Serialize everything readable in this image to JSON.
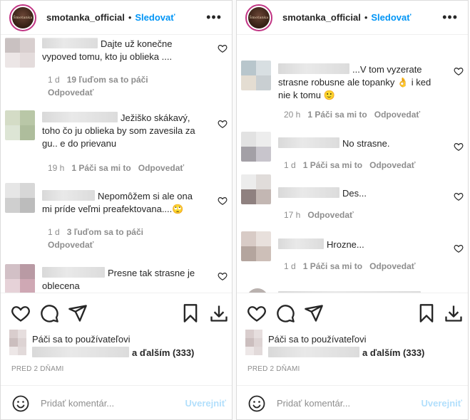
{
  "colors": {
    "accent": "#0095f6",
    "muted": "#8e8e8e",
    "text": "#262626",
    "post_disabled": "#b2dffc"
  },
  "left": {
    "username": "smotanka_official",
    "follow": "Sledovať",
    "avatar_text": "Šmotanka",
    "comments": [
      {
        "text": "Dajte už konečne vypoved tomu, kto ju oblieka ....",
        "time": "1 d",
        "likes": "19 ľuďom sa to páči",
        "reply": "Odpovedať"
      },
      {
        "text": "Ježiško skákavý, toho čo ju oblieka by som zavesila za gu.. e do prievanu",
        "time": "19 h",
        "likes": "1 Páči sa mi to",
        "reply": "Odpovedať"
      },
      {
        "text": "Nepomôžem si ale ona mi príde veľmi preafektovana....🙄",
        "time": "1 d",
        "likes": "3 ľuďom sa to páči",
        "reply": "Odpovedať"
      },
      {
        "text": "Presne tak strasne je oblecena",
        "time": "",
        "likes": "",
        "reply": ""
      }
    ],
    "likes_line1": "Páči sa to používateľovi",
    "likes_and": "a ďalším (333)",
    "date": "PRED 2 DŇAMI",
    "comment_placeholder": "Pridať komentár...",
    "post_label": "Uverejniť"
  },
  "right": {
    "username": "smotanka_official",
    "follow": "Sledovať",
    "avatar_text": "Šmotanka",
    "comments": [
      {
        "text": "...V tom vyzerate strasne robusne ale topanky 👌 i ked nie k tomu 🙂",
        "time": "20 h",
        "likes": "1 Páči sa mi to",
        "reply": "Odpovedať"
      },
      {
        "text": "No strasne.",
        "time": "1 d",
        "likes": "1 Páči sa mi to",
        "reply": "Odpovedať"
      },
      {
        "text": "Des...",
        "time": "17 h",
        "likes": "",
        "reply": "Odpovedať"
      },
      {
        "text": "Hrozne...",
        "time": "1 d",
        "likes": "1 Páči sa mi to",
        "reply": "Odpovedať"
      }
    ],
    "likes_line1": "Páči sa to používateľovi",
    "likes_and": "a ďalším (333)",
    "date": "PRED 2 DŇAMI",
    "comment_placeholder": "Pridať komentár...",
    "post_label": "Uverejniť"
  },
  "icons": {
    "more": "more-options-icon",
    "heart": "heart-icon",
    "comment": "comment-icon",
    "share": "share-icon",
    "bookmark": "bookmark-icon",
    "download": "download-icon",
    "emoji": "emoji-icon"
  }
}
